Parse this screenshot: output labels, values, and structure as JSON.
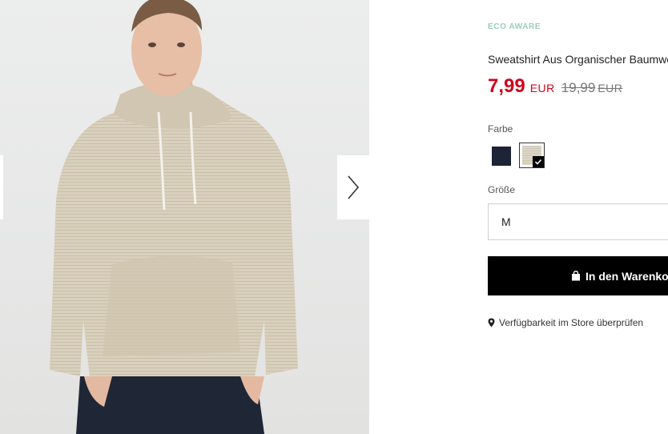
{
  "product": {
    "badge": "ECO AWARE",
    "title": "Sweatshirt Aus Organischer Baumwolle",
    "price_current": "7,99",
    "currency_current": "EUR",
    "price_old": "19,99",
    "currency_old": "EUR"
  },
  "color": {
    "label": "Farbe",
    "options": [
      {
        "name": "navy",
        "hex": "#1c2436",
        "selected": false
      },
      {
        "name": "beige",
        "hex": "#d8d0bf",
        "selected": true
      }
    ]
  },
  "size": {
    "label": "Größe",
    "selected": "M"
  },
  "cart": {
    "button_label": "In den Warenkorb"
  },
  "store": {
    "link_label": "Verfügbarkeit im Store überprüfen"
  },
  "colors": {
    "sale_red": "#d0021b",
    "eco_green": "#9ccdbd"
  },
  "icons": [
    "chevron-right-icon",
    "shopping-bag-icon",
    "location-pin-icon",
    "checkmark-icon"
  ]
}
